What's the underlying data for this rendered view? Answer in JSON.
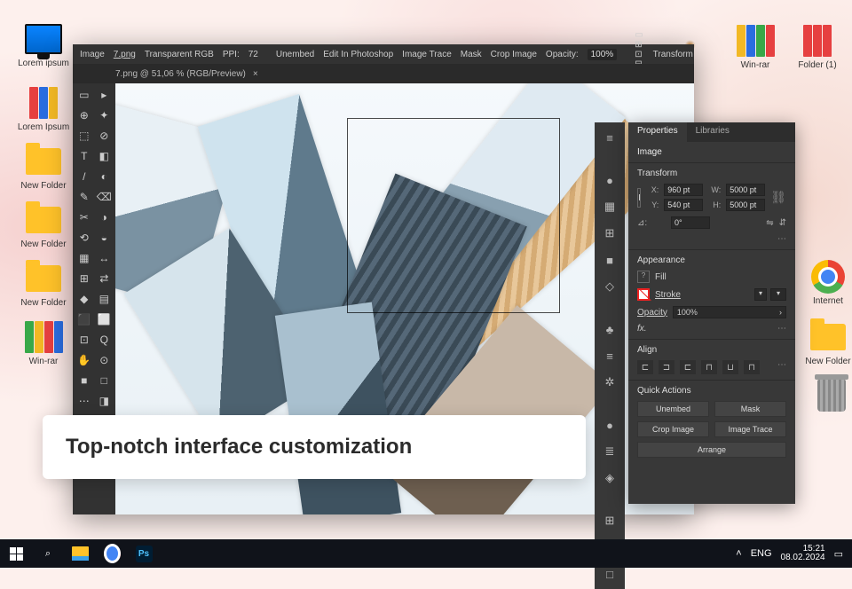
{
  "desktop": {
    "icons_left": [
      {
        "name": "computer",
        "label": "Lorem ipsum"
      },
      {
        "name": "binders",
        "label": "Lorem Ipsum"
      },
      {
        "name": "folder",
        "label": "New Folder"
      },
      {
        "name": "folder",
        "label": "New Folder"
      },
      {
        "name": "folder",
        "label": "New Folder"
      },
      {
        "name": "binders2",
        "label": "Win-rar"
      }
    ],
    "icons_right": [
      {
        "name": "binders",
        "label": "Win-rar"
      },
      {
        "name": "binders",
        "label": "Folder (1)"
      },
      {
        "name": "chrome",
        "label": "Internet"
      },
      {
        "name": "folder",
        "label": "New Folder"
      },
      {
        "name": "trash",
        "label": ""
      }
    ]
  },
  "ai": {
    "menu": {
      "image": "Image",
      "file": "7.png",
      "color_mode": "Transparent RGB",
      "ppi_label": "PPI:",
      "ppi": "72",
      "unembed": "Unembed",
      "edit_ps": "Edit In Photoshop",
      "trace": "Image Trace",
      "mask": "Mask",
      "crop": "Crop Image",
      "opacity_label": "Opacity:",
      "opacity": "100%",
      "transform": "Transform"
    },
    "tab": "7.png @ 51,06 % (RGB/Preview)",
    "tools": [
      "▭",
      "▸",
      "⊕",
      "✦",
      "⬚",
      "⊘",
      "T",
      "◧",
      "/",
      "◐",
      "✎",
      "⌫",
      "✂",
      "◑",
      "⟲",
      "◒",
      "▦",
      "↔",
      "⊞",
      "⇄",
      "◆",
      "▤",
      "⬛",
      "⬜",
      "⊡",
      "Q",
      "✋",
      "⊙",
      "■",
      "□",
      "⋯",
      "◨",
      "◩",
      "◪"
    ]
  },
  "dock": [
    "≡",
    "●",
    "▦",
    "⊞",
    "■",
    "◇",
    "♣",
    "≡",
    "✲",
    "●",
    "≣",
    "◈",
    "⊞",
    "◳",
    "□"
  ],
  "props": {
    "tab_properties": "Properties",
    "tab_libraries": "Libraries",
    "subtitle": "Image",
    "transform": {
      "title": "Transform",
      "x_label": "X:",
      "x": "960 pt",
      "y_label": "Y:",
      "y": "540 pt",
      "w_label": "W:",
      "w": "5000 pt",
      "h_label": "H:",
      "h": "5000 pt",
      "angle_label": "⊿:",
      "angle": "0°"
    },
    "appearance": {
      "title": "Appearance",
      "fill": "Fill",
      "stroke": "Stroke",
      "opacity_label": "Opacity",
      "opacity": "100%",
      "fx": "fx."
    },
    "align": {
      "title": "Align"
    },
    "quick": {
      "title": "Quick Actions",
      "unembed": "Unembed",
      "mask": "Mask",
      "crop": "Crop Image",
      "trace": "Image Trace",
      "arrange": "Arrange"
    }
  },
  "caption": "Top-notch interface customization",
  "taskbar": {
    "lang": "ENG",
    "time": "15:21",
    "date": "08.02.2024",
    "ps": "Ps"
  }
}
